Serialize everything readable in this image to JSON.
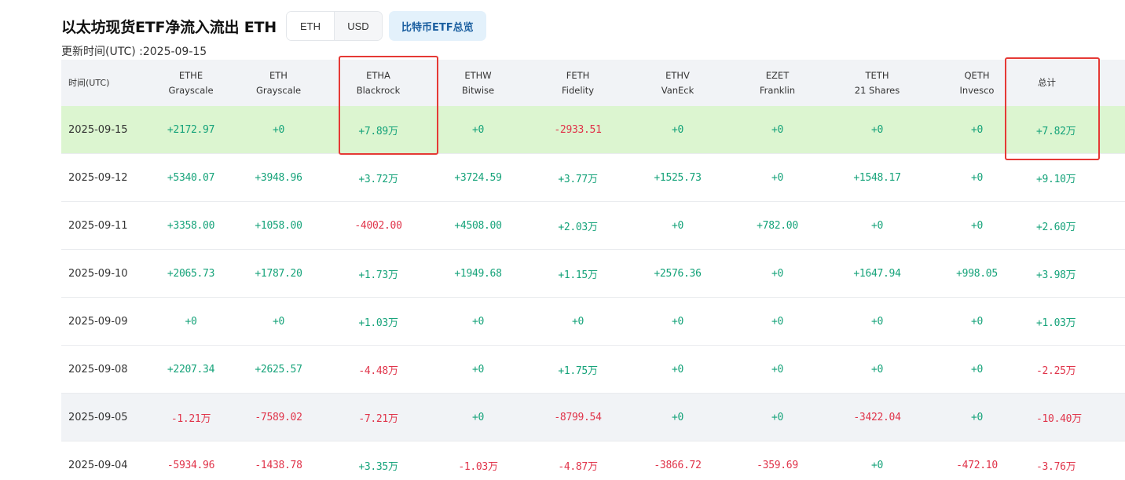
{
  "header": {
    "title": "以太坊现货ETF净流入流出 ETH",
    "toggle": [
      {
        "label": "ETH",
        "active": true
      },
      {
        "label": "USD",
        "active": false
      }
    ],
    "btc_button": "比特币ETF总览",
    "update_time": "更新时间(UTC) :2025-09-15"
  },
  "colors": {
    "positive": "#16a37a",
    "negative": "#e0344a",
    "highlight_row": "#dcf5d0",
    "annotation": "#e53935"
  },
  "table": {
    "date_header": "时间(UTC)",
    "columns": [
      {
        "ticker": "ETHE",
        "issuer": "Grayscale"
      },
      {
        "ticker": "ETH",
        "issuer": "Grayscale"
      },
      {
        "ticker": "ETHA",
        "issuer": "Blackrock"
      },
      {
        "ticker": "ETHW",
        "issuer": "Bitwise"
      },
      {
        "ticker": "FETH",
        "issuer": "Fidelity"
      },
      {
        "ticker": "ETHV",
        "issuer": "VanEck"
      },
      {
        "ticker": "EZET",
        "issuer": "Franklin"
      },
      {
        "ticker": "TETH",
        "issuer": "21 Shares"
      },
      {
        "ticker": "QETH",
        "issuer": "Invesco"
      }
    ],
    "total_header": "总计",
    "rows": [
      {
        "date": "2025-09-15",
        "values": [
          "+2172.97",
          "+0",
          "+7.89万",
          "+0",
          "-2933.51",
          "+0",
          "+0",
          "+0",
          "+0"
        ],
        "total": "+7.82万"
      },
      {
        "date": "2025-09-12",
        "values": [
          "+5340.07",
          "+3948.96",
          "+3.72万",
          "+3724.59",
          "+3.77万",
          "+1525.73",
          "+0",
          "+1548.17",
          "+0"
        ],
        "total": "+9.10万"
      },
      {
        "date": "2025-09-11",
        "values": [
          "+3358.00",
          "+1058.00",
          "-4002.00",
          "+4508.00",
          "+2.03万",
          "+0",
          "+782.00",
          "+0",
          "+0"
        ],
        "total": "+2.60万"
      },
      {
        "date": "2025-09-10",
        "values": [
          "+2065.73",
          "+1787.20",
          "+1.73万",
          "+1949.68",
          "+1.15万",
          "+2576.36",
          "+0",
          "+1647.94",
          "+998.05"
        ],
        "total": "+3.98万"
      },
      {
        "date": "2025-09-09",
        "values": [
          "+0",
          "+0",
          "+1.03万",
          "+0",
          "+0",
          "+0",
          "+0",
          "+0",
          "+0"
        ],
        "total": "+1.03万"
      },
      {
        "date": "2025-09-08",
        "values": [
          "+2207.34",
          "+2625.57",
          "-4.48万",
          "+0",
          "+1.75万",
          "+0",
          "+0",
          "+0",
          "+0"
        ],
        "total": "-2.25万"
      },
      {
        "date": "2025-09-05",
        "values": [
          "-1.21万",
          "-7589.02",
          "-7.21万",
          "+0",
          "-8799.54",
          "+0",
          "+0",
          "-3422.04",
          "+0"
        ],
        "total": "-10.40万"
      },
      {
        "date": "2025-09-04",
        "values": [
          "-5934.96",
          "-1438.78",
          "+3.35万",
          "-1.03万",
          "-4.87万",
          "-3866.72",
          "-359.69",
          "+0",
          "-472.10"
        ],
        "total": "-3.76万"
      }
    ]
  }
}
